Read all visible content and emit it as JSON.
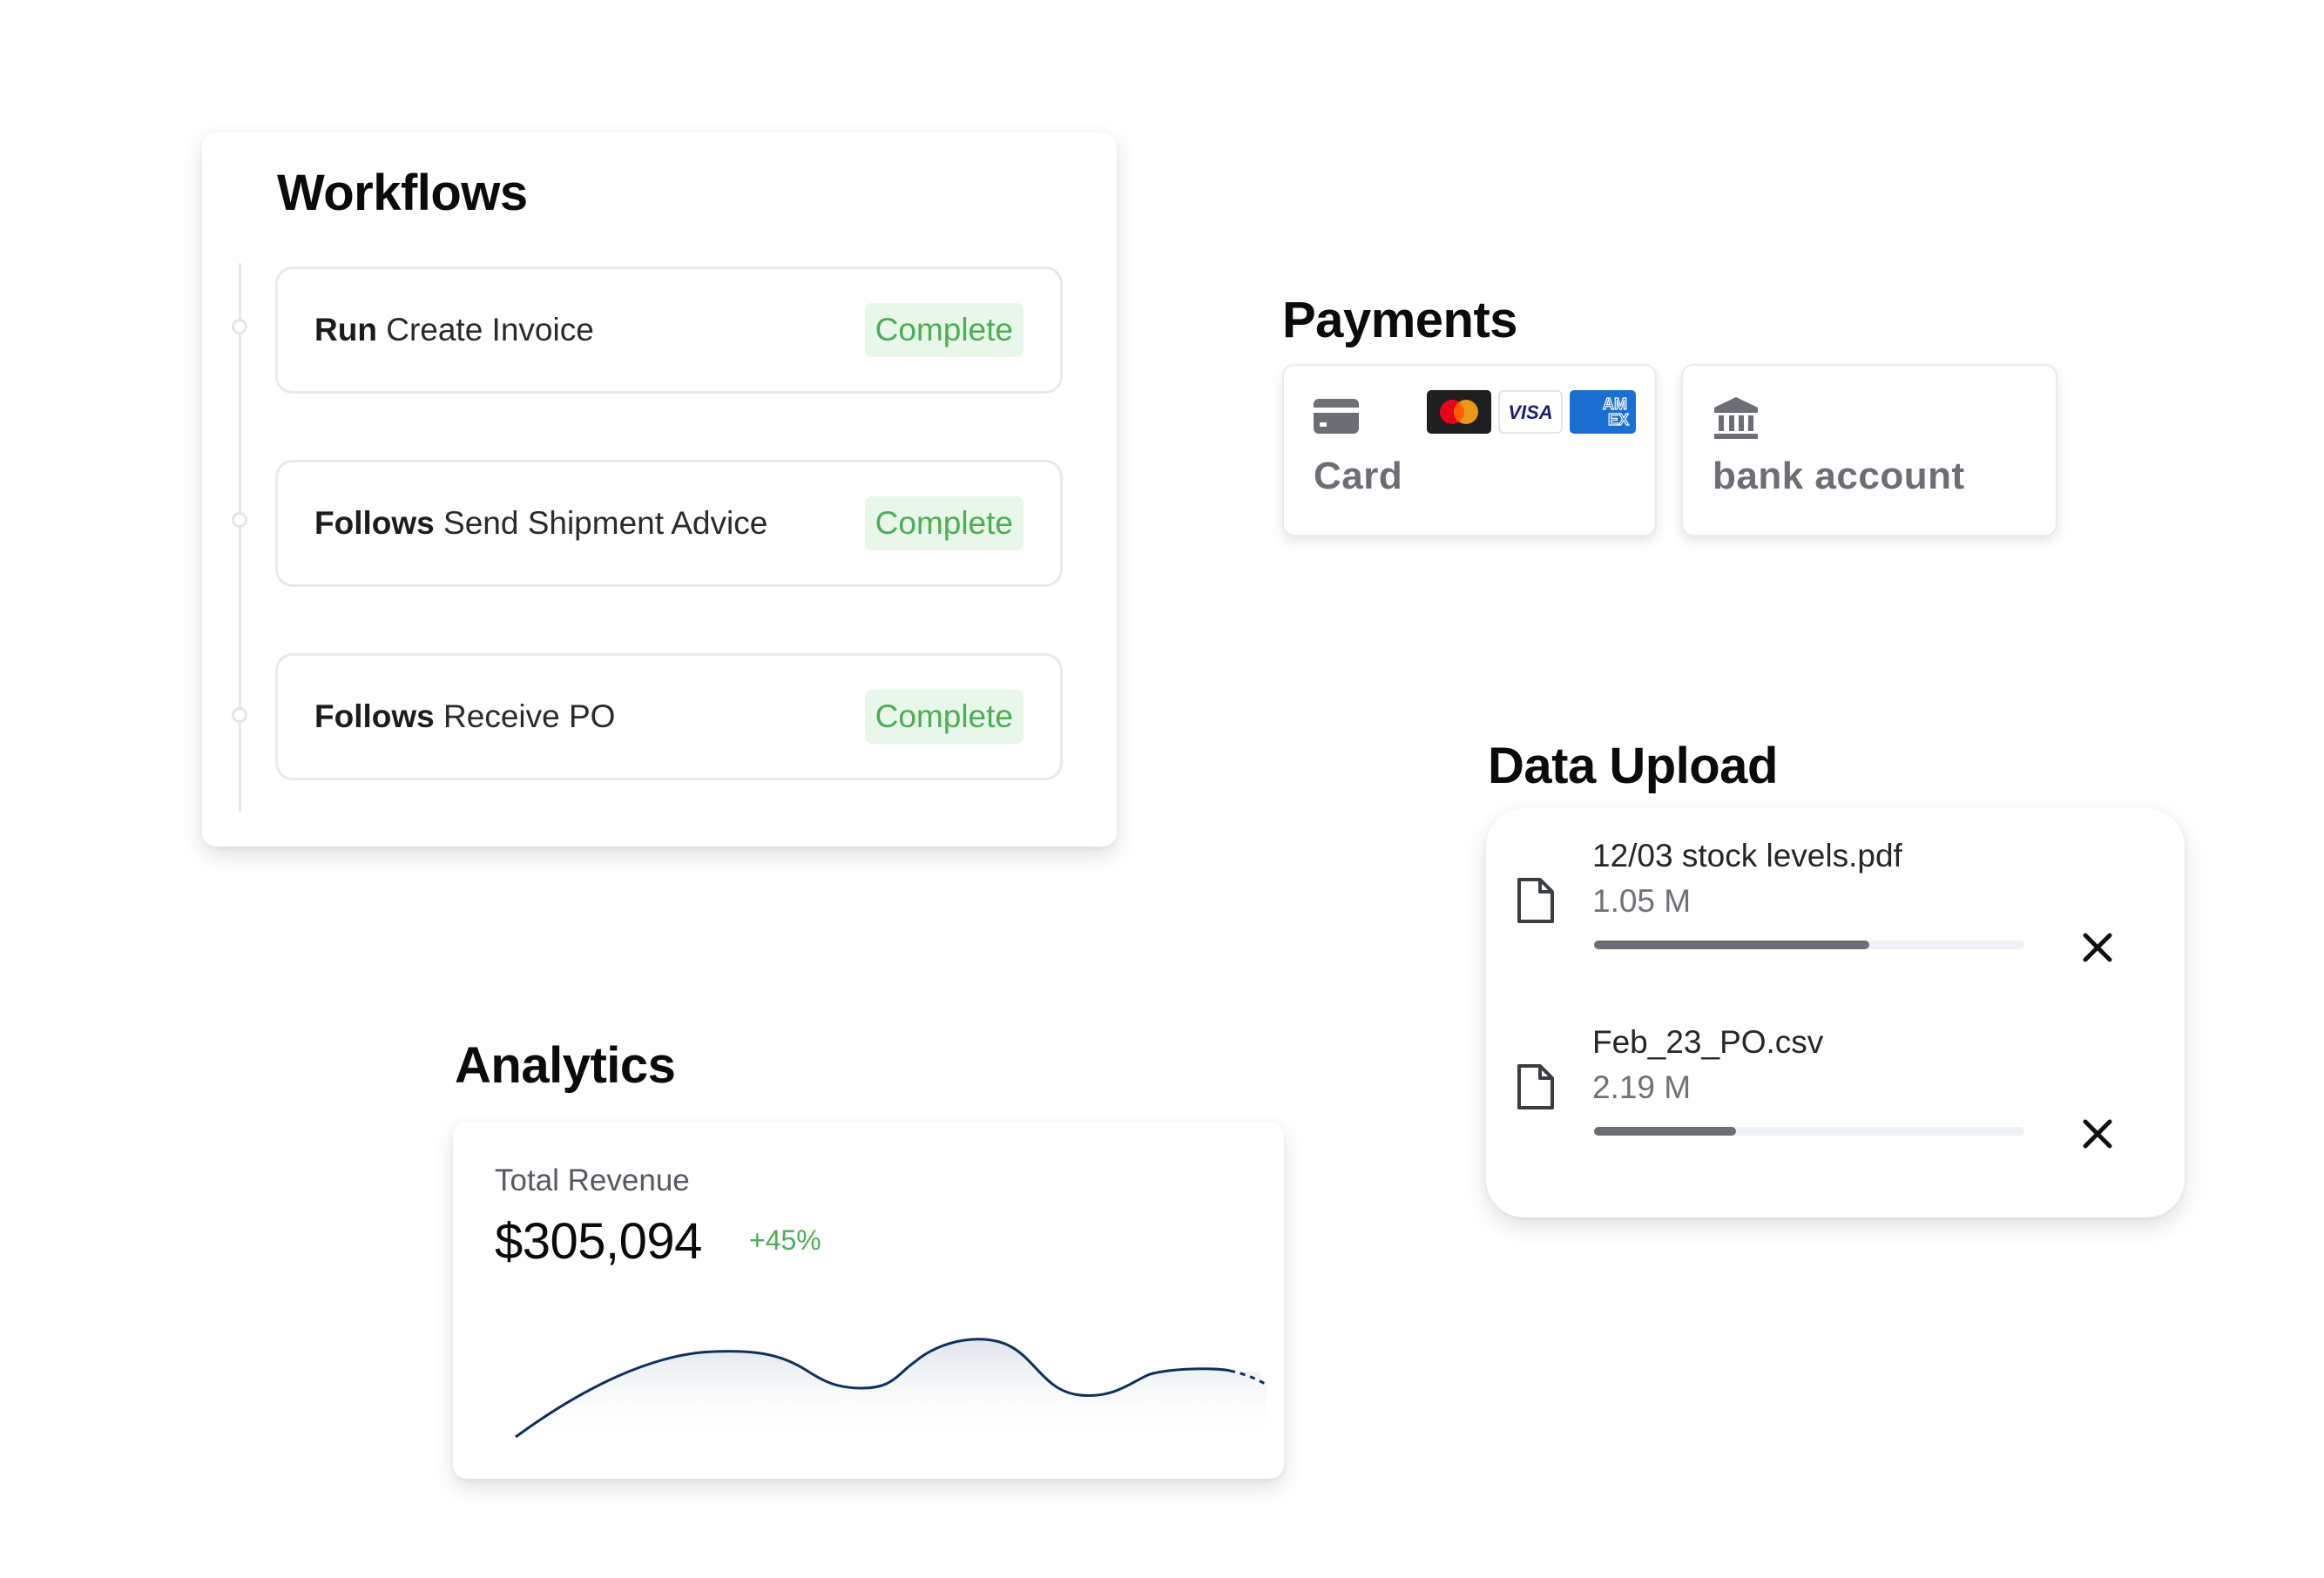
{
  "workflows": {
    "title": "Workflows",
    "items": [
      {
        "verb": "Run",
        "name": "Create Invoice",
        "status": "Complete"
      },
      {
        "verb": "Follows",
        "name": "Send Shipment Advice",
        "status": "Complete"
      },
      {
        "verb": "Follows",
        "name": "Receive PO",
        "status": "Complete"
      }
    ]
  },
  "payments": {
    "title": "Payments",
    "options": [
      {
        "label": "Card",
        "icon": "credit-card-icon",
        "brands": [
          "mastercard-icon",
          "visa-icon",
          "amex-icon"
        ]
      },
      {
        "label": "bank account",
        "icon": "bank-icon"
      }
    ],
    "brand_text": {
      "visa": "VISA",
      "amex_top": "AM",
      "amex_bottom": "EX"
    }
  },
  "analytics": {
    "title": "Analytics",
    "metric_label": "Total Revenue",
    "metric_value": "$305,094",
    "change": "+45%",
    "colors": {
      "line": "#0f2f5e",
      "change": "#4cae55"
    }
  },
  "data_upload": {
    "title": "Data Upload",
    "files": [
      {
        "name": "12/03 stock levels.pdf",
        "size": "1.05 M",
        "progress": 0.64,
        "icon": "file-icon",
        "remove_icon": "close-icon"
      },
      {
        "name": "Feb_23_PO.csv",
        "size": "2.19 M",
        "progress": 0.33,
        "icon": "file-icon",
        "remove_icon": "close-icon"
      }
    ]
  }
}
